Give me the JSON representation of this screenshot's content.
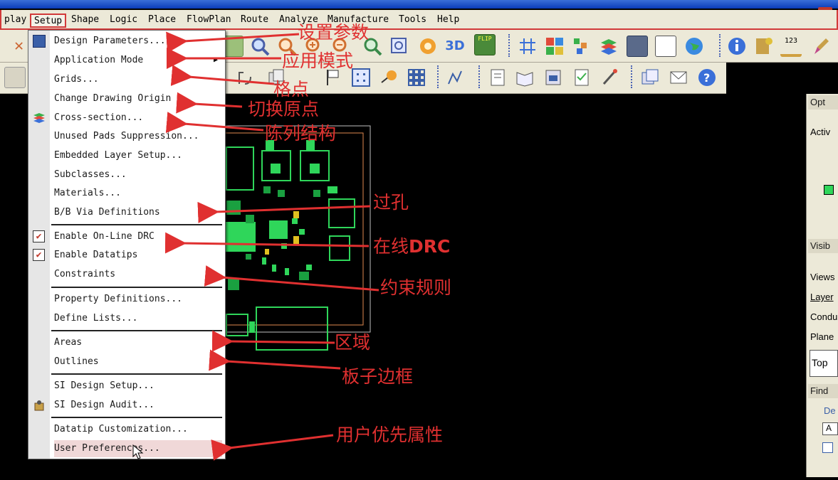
{
  "window": {
    "close_label": "×"
  },
  "menubar": {
    "items": [
      "play",
      "Setup",
      "Shape",
      "Logic",
      "Place",
      "FlowPlan",
      "Route",
      "Analyze",
      "Manufacture",
      "Tools",
      "Help"
    ]
  },
  "setup_menu": {
    "items": [
      "Design Parameters...",
      "Application Mode",
      "Grids...",
      "Change Drawing Origin",
      "Cross-section...",
      "Unused Pads Suppression...",
      "Embedded Layer Setup...",
      "Subclasses...",
      "Materials...",
      "B/B Via Definitions",
      "Enable On-Line DRC",
      "Enable Datatips",
      "Constraints",
      "Property Definitions...",
      "Define Lists...",
      "Areas",
      "Outlines",
      "SI Design Setup...",
      "SI Design Audit...",
      "Datatip Customization...",
      "User Preferences..."
    ],
    "check_mark": "✔",
    "submenu_arrow": "▶"
  },
  "annotations": {
    "design_parameters": "设置参数",
    "application_mode": "应用模式",
    "grids": "格点",
    "change_origin": "切换原点",
    "cross_section": "陈列结构",
    "via": "过孔",
    "online_drc_prefix": "在线",
    "online_drc_suffix": "DRC",
    "constraints": "约束规则",
    "areas": "区域",
    "outlines": "板子边框",
    "user_preferences": "用户优先属性"
  },
  "right_panel": {
    "options_title": "Opt",
    "active": "Activ",
    "visibility_title": "Visib",
    "views": "Views",
    "layer": "Layer",
    "conductors": "Condu",
    "planes": "Plane",
    "layer_select": "Top",
    "find_title": "Find",
    "design": "De",
    "all_button": "A"
  },
  "toolbar_labels": {
    "flip": "FLIP",
    "three_d": "3D",
    "ruler": "123"
  }
}
